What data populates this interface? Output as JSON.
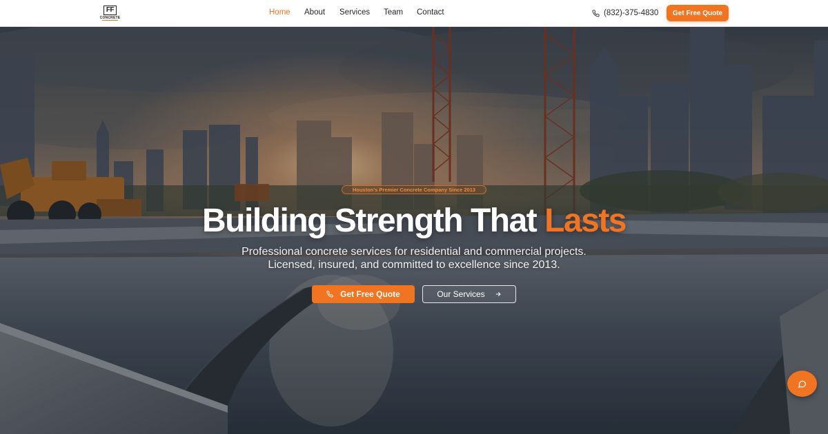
{
  "brand": {
    "logo_mark": "FF",
    "logo_text": "CONCRETE",
    "accent_color": "#f07421"
  },
  "nav": {
    "items": [
      {
        "label": "Home",
        "active": true
      },
      {
        "label": "About",
        "active": false
      },
      {
        "label": "Services",
        "active": false
      },
      {
        "label": "Team",
        "active": false
      },
      {
        "label": "Contact",
        "active": false
      }
    ]
  },
  "header": {
    "phone": "(832)-375-4830",
    "phone_icon": "phone-icon",
    "cta_label": "Get Free Quote"
  },
  "hero": {
    "badge": "Houston's Premier Concrete Company Since 2013",
    "headline_main": "Building Strength That",
    "headline_accent": "Lasts",
    "subline_1": "Professional concrete services for residential and commercial projects.",
    "subline_2": "Licensed, insured, and committed to excellence since 2013.",
    "primary_button": "Get Free Quote",
    "primary_icon": "phone-icon",
    "secondary_button": "Our Services",
    "secondary_icon": "arrow-right-icon"
  },
  "chat": {
    "icon": "chat-bubble-icon"
  }
}
